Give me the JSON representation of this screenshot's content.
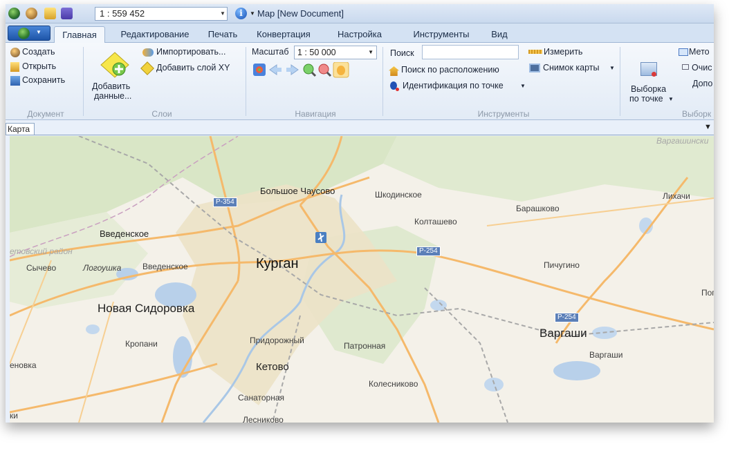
{
  "qat": {
    "scale_value": "1 : 559 452",
    "window_title": "Map [New Document]"
  },
  "tabs": [
    "Главная",
    "Редактирование",
    "Печать",
    "Конвертация",
    "Настройка",
    "Инструменты",
    "Вид"
  ],
  "ribbon": {
    "document": {
      "create": "Создать",
      "open": "Открыть",
      "save": "Сохранить",
      "group": "Документ"
    },
    "layers": {
      "add_data_l1": "Добавить",
      "add_data_l2": "данные...",
      "import": "Импортировать...",
      "add_xy": "Добавить слой XY",
      "group": "Слои"
    },
    "navigation": {
      "scale_label": "Масштаб",
      "scale_value": "1 : 50 000",
      "group": "Навигация"
    },
    "tools": {
      "search_label": "Поиск",
      "search_value": "",
      "search_location": "Поиск по расположению",
      "identify": "Идентификация по точке",
      "measure": "Измерить",
      "snapshot": "Снимок карты",
      "group": "Инструменты"
    },
    "selection": {
      "select_l1": "Выборка",
      "select_l2": "по точке",
      "method": "Мето",
      "clear": "Очис",
      "extra": "Допо",
      "group": "Выборк"
    }
  },
  "map_tab": "Карта",
  "map_labels": {
    "kurgan": "Курган",
    "bolshoe_chausovo": "Большое Чаусово",
    "shkodinskoe": "Шкодинское",
    "koltashevo": "Колташево",
    "barashkovo": "Барашково",
    "likhachi": "Лихачи",
    "varg_top": "Варгашински",
    "vvedenskoe_1": "Введенское",
    "vvedenskoe_2": "Введенское",
    "raion": "етовский район",
    "sychevo": "Сычево",
    "logoushka": "Логоушка",
    "novaya_sidorovka": "Новая Сидоровка",
    "pichugino": "Пичугино",
    "pog": "Пог",
    "vargashi_big": "Варгаши",
    "vargashi_small": "Варгаши",
    "kropani": "Кропани",
    "pridorozhny": "Придорожный",
    "patronnaya": "Патронная",
    "enovka": "еновка",
    "ketovo": "Кетово",
    "kolesnikovo": "Колесниково",
    "sanatornaya": "Санаторная",
    "ki": "ки",
    "lesnikovo": "Лесниково",
    "r354": "Р-354",
    "r254a": "Р-254",
    "r254b": "Р-254"
  },
  "colors": {
    "road": "#f5b96b",
    "water": "#b8d0ea",
    "forest": "#d7e5c5",
    "urban": "#ece2c6",
    "map_bg": "#f4f1e9"
  }
}
